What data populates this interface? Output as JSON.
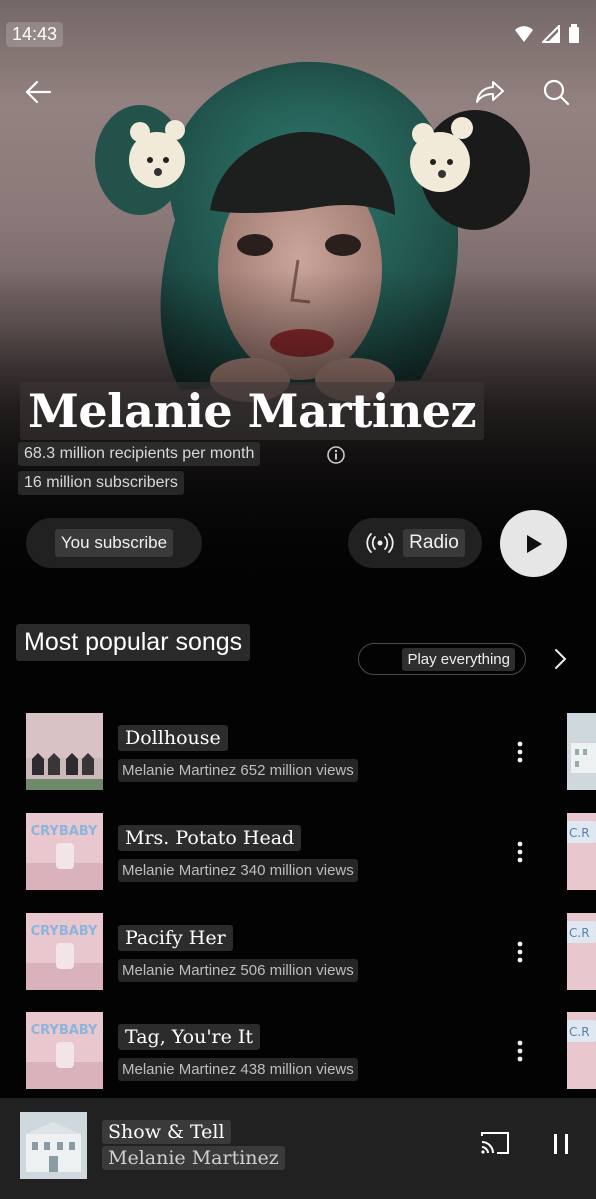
{
  "status": {
    "time": "14:43"
  },
  "artist": {
    "name": "Melanie Martinez",
    "monthly": "68.3 million recipients per month",
    "subscribers": "16 million subscribers"
  },
  "actions": {
    "subscribe_label": "You subscribe",
    "radio_label": "Radio"
  },
  "section": {
    "title": "Most popular songs",
    "play_all_label": "Play everything"
  },
  "songs": [
    {
      "title": "Dollhouse",
      "subtitle": "Melanie Martinez 652 million views",
      "album_text": ""
    },
    {
      "title": "Mrs. Potato Head",
      "subtitle": "Melanie Martinez 340 million views",
      "album_text": "CRYBABY"
    },
    {
      "title": "Pacify Her",
      "subtitle": "Melanie Martinez 506 million views",
      "album_text": "CRYBABY"
    },
    {
      "title": "Tag, You're It",
      "subtitle": "Melanie Martinez 438 million views",
      "album_text": "CRYBABY"
    }
  ],
  "peek_label": "C.R",
  "now_playing": {
    "title": "Show & Tell",
    "artist": "Melanie Martinez"
  },
  "colors": {
    "background": "#030303",
    "hair": "#2f6b60",
    "play_button": "#e6e6e6",
    "mini_player": "#212121",
    "crybaby_pink": "#e8c7cf",
    "crybaby_blue": "#8cb4de"
  },
  "icons": [
    "back-arrow-icon",
    "share-icon",
    "search-icon",
    "info-icon",
    "radio-icon",
    "play-icon",
    "chevron-right-icon",
    "more-vert-icon",
    "cast-icon",
    "pause-icon"
  ]
}
